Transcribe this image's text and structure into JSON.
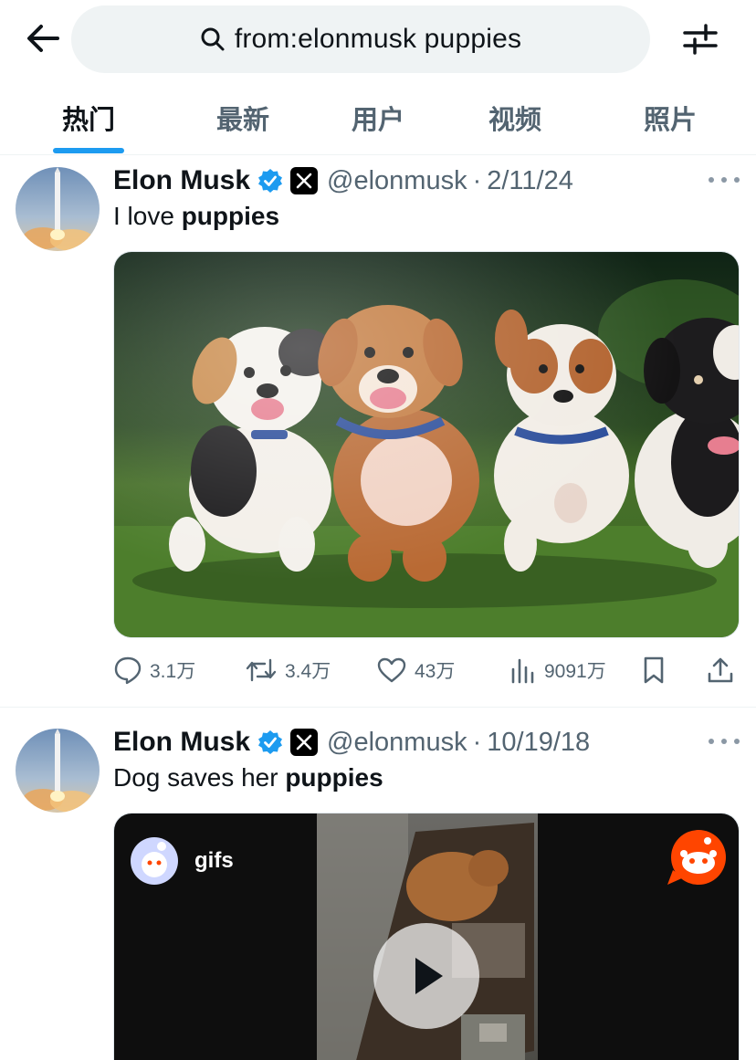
{
  "search": {
    "query": "from:elonmusk puppies"
  },
  "icons": {
    "back": "arrow-left-icon",
    "search": "search-icon",
    "filter": "sliders-icon",
    "verified": "verified-badge-icon",
    "x_affiliate": "x-logo-icon",
    "more": "more-dots-icon",
    "reply": "reply-icon",
    "retweet": "retweet-icon",
    "like": "heart-icon",
    "views": "views-chart-icon",
    "bookmark": "bookmark-icon",
    "share": "share-icon",
    "play": "play-icon",
    "reddit": "reddit-logo-icon"
  },
  "tabs": [
    {
      "label": "热门",
      "active": true
    },
    {
      "label": "最新",
      "active": false
    },
    {
      "label": "用户",
      "active": false
    },
    {
      "label": "视频",
      "active": false
    },
    {
      "label": "照片",
      "active": false
    }
  ],
  "colors": {
    "accent": "#1d9bf0",
    "secondary_text": "#536471",
    "primary_text": "#0f1419",
    "search_bg": "#eff3f4"
  },
  "tweets": [
    {
      "name": "Elon Musk",
      "handle": "@elonmusk",
      "separator": "·",
      "date": "2/11/24",
      "text_plain": "I love ",
      "text_bold": "puppies",
      "media": "puppies-photo",
      "stats": {
        "replies": "3.1万",
        "retweets": "3.4万",
        "likes": "43万",
        "views": "9091万"
      }
    },
    {
      "name": "Elon Musk",
      "handle": "@elonmusk",
      "separator": "·",
      "date": "10/19/18",
      "text_plain": "Dog saves her ",
      "text_bold": "puppies",
      "media": "video-player",
      "video_source": "gifs"
    }
  ]
}
